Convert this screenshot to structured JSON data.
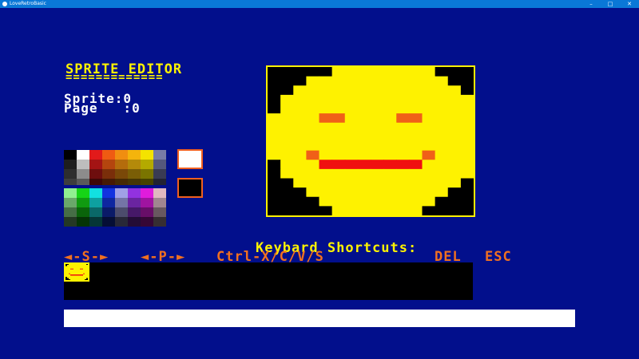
{
  "window": {
    "title": "LoveRetroBasic",
    "minimize": "–",
    "maximize": "□",
    "close": "✕"
  },
  "editor": {
    "title": "SPRITE EDITOR",
    "underline": "=============",
    "sprite_label": "Sprite:0",
    "page_label": "Page   :0"
  },
  "palette": {
    "colors": [
      "#000000",
      "#ffffff",
      "#e21a1a",
      "#ef5b12",
      "#f08e10",
      "#f4b40c",
      "#f4e300",
      "#777ba6",
      "#1e1e1e",
      "#bdbdbd",
      "#a41414",
      "#b4450e",
      "#b46c0c",
      "#b48a0a",
      "#b4aa00",
      "#55587c",
      "#2e2e2e",
      "#8c8c8c",
      "#6e0e0e",
      "#7a2e0a",
      "#7a4808",
      "#7a5e06",
      "#7a7400",
      "#393b53",
      "#3e3e3e",
      "#5a5a5a",
      "#3e0808",
      "#461a06",
      "#462a04",
      "#463604",
      "#464200",
      "#222333",
      "#90f090",
      "#16d416",
      "#12e0e0",
      "#1232e0",
      "#a0a0e6",
      "#9232e0",
      "#e01cdc",
      "#e0b8c0",
      "#6aa86a",
      "#109a10",
      "#0ea0a0",
      "#0e26a0",
      "#7474a6",
      "#6a24a0",
      "#a014a0",
      "#a08690",
      "#466e46",
      "#0a640a",
      "#0a6868",
      "#0a1a68",
      "#4c4c6c",
      "#461868",
      "#680e68",
      "#685860",
      "#243824",
      "#053405",
      "#053636",
      "#050e36",
      "#282838",
      "#240c36",
      "#360736",
      "#362e32"
    ],
    "foreground_color": "#ffffff",
    "background_color": "#000000"
  },
  "canvas": {
    "grid": [
      "0000044444444000",
      "0004444444444400",
      "0044444444444440",
      "0444444444444444",
      "0444444444444444",
      "4444224444224444",
      "4444444444444444",
      "4444444444444444",
      "4444444444444444",
      "4442444444442444",
      "0444222222224444",
      "0444444444444444",
      "0044444444444440",
      "0004444444444400",
      "0000444444444000",
      "0000044444440000"
    ],
    "pixel_colors": {
      "0": "#000000",
      "2": "#f06018",
      "3": "#f01010",
      "4": "#fef200"
    }
  },
  "shortcuts": {
    "title": "Keybard Shortcuts:",
    "sprite_nav": "◄-S-►",
    "page_nav": "◄-P-►",
    "clipboard": "Ctrl-X/C/V/S",
    "delete": "DEL",
    "escape": "ESC"
  },
  "command": {
    "value": ""
  }
}
